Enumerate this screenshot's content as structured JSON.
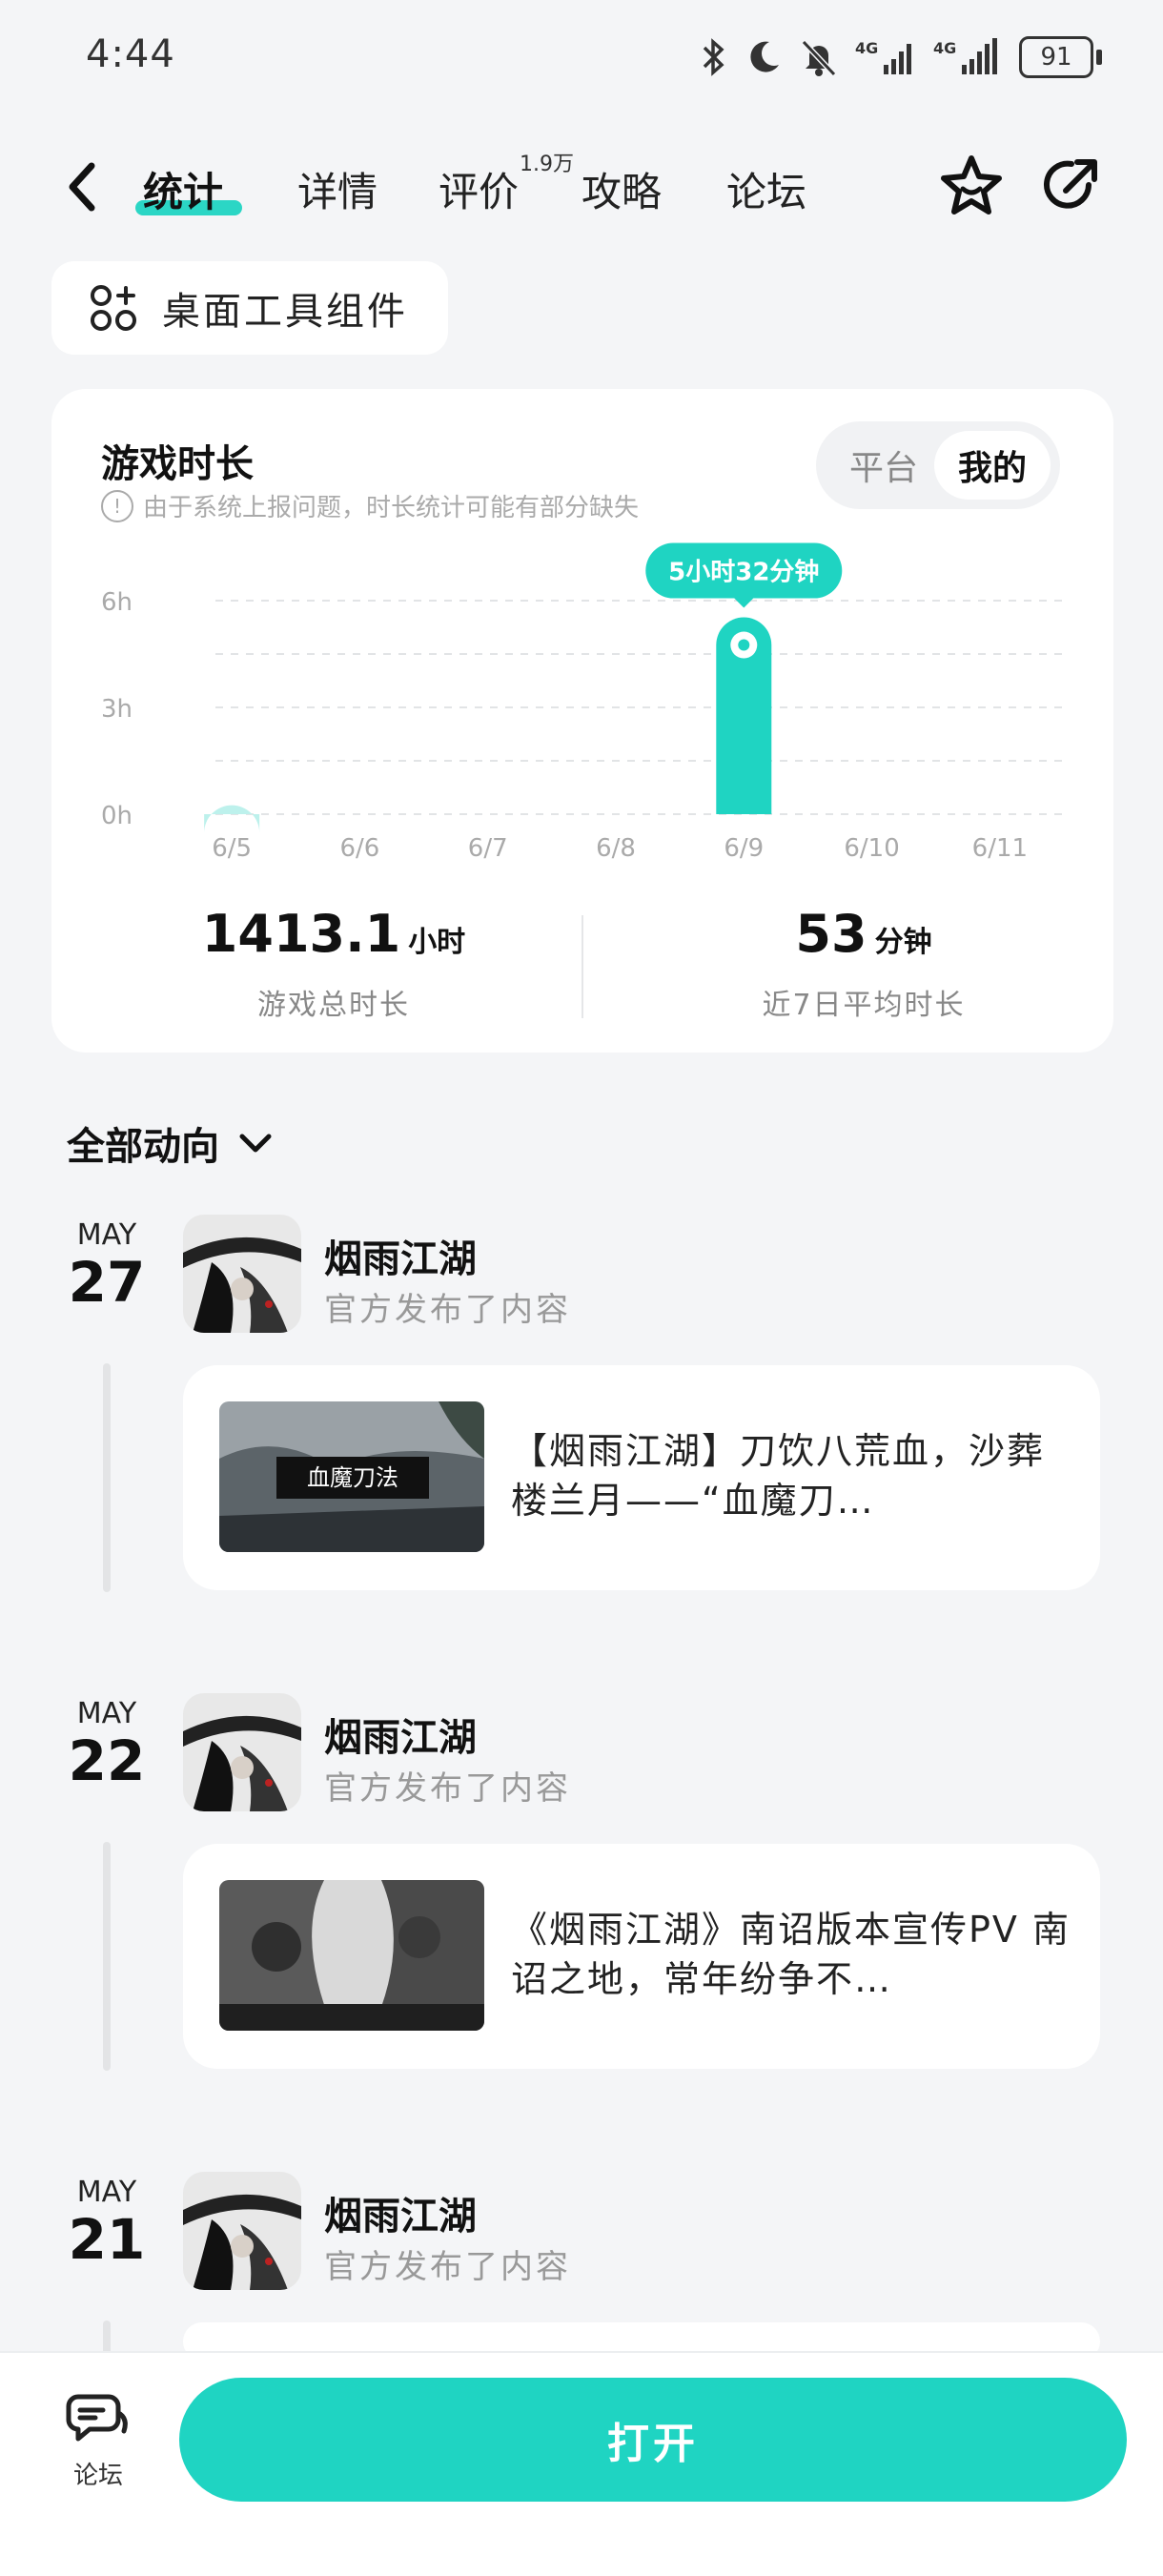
{
  "status_bar": {
    "time": "4:44",
    "battery": "91",
    "signal_1": "4G",
    "signal_2": "4G"
  },
  "header": {
    "tabs": [
      {
        "label": "统计",
        "active": true
      },
      {
        "label": "详情"
      },
      {
        "label": "评价",
        "badge": "1.9万"
      },
      {
        "label": "攻略"
      },
      {
        "label": "论坛"
      }
    ]
  },
  "widget_chip": {
    "label": "桌面工具组件"
  },
  "playtime": {
    "title": "游戏时长",
    "notice": "由于系统上报问题，时长统计可能有部分缺失",
    "segment": [
      "平台",
      "我的"
    ],
    "segment_selected": "我的",
    "tooltip": "5小时32分钟",
    "total_value": "1413.1",
    "total_unit": "小时",
    "total_caption": "游戏总时长",
    "avg_value": "53",
    "avg_unit": "分钟",
    "avg_caption": "近7日平均时长"
  },
  "chart_data": {
    "type": "bar",
    "categories": [
      "6/5",
      "6/6",
      "6/7",
      "6/8",
      "6/9",
      "6/10",
      "6/11"
    ],
    "values": [
      0.25,
      0,
      0,
      0,
      5.53,
      0,
      0
    ],
    "y_ticks": [
      "0h",
      "3h",
      "6h"
    ],
    "ylim": [
      0,
      6
    ],
    "grid": true,
    "highlight_index": 4,
    "colors": {
      "bar": "#1fd4c2",
      "bar_light": "#bdf1ec",
      "tooltip": "#1fd4c2"
    }
  },
  "feed": {
    "header": "全部动向",
    "items": [
      {
        "month": "MAY",
        "day": "27",
        "name": "烟雨江湖",
        "sub": "官方发布了内容",
        "post_title": "【烟雨江湖】刀饮八荒血，沙葬楼兰月——“血魔刀…",
        "thumb_text": "血魔刀法"
      },
      {
        "month": "MAY",
        "day": "22",
        "name": "烟雨江湖",
        "sub": "官方发布了内容",
        "post_title": "《烟雨江湖》南诏版本宣传PV 南诏之地，常年纷争不…"
      },
      {
        "month": "MAY",
        "day": "21",
        "name": "烟雨江湖",
        "sub": "官方发布了内容"
      }
    ]
  },
  "bottom_bar": {
    "forum_label": "论坛",
    "open_label": "打开"
  },
  "colors": {
    "accent": "#1fd4c2",
    "background": "#f4f5f7"
  }
}
